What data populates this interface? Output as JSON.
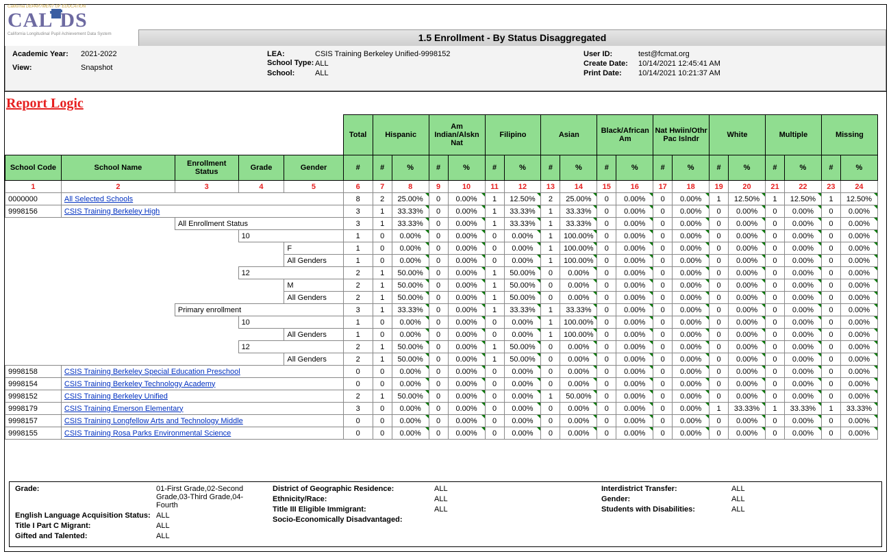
{
  "logo": {
    "top": "California DEPARTMENT OF EDUCATION",
    "main1": "CAL",
    "main2": "P",
    "main3": "DS",
    "sub": "California Longitudinal Pupil Achievement Data System"
  },
  "title": "1.5  Enrollment - By Status Disaggregated",
  "meta": {
    "ay_label": "Academic Year:",
    "ay": "2021-2022",
    "view_label": "View:",
    "view": "Snapshot",
    "lea_label": "LEA:",
    "lea": "CSIS Training Berkeley Unified-9998152",
    "st_label": "School Type:",
    "st": "ALL",
    "school_label": "School:",
    "school": "ALL",
    "uid_label": "User ID:",
    "uid": "test@fcmat.org",
    "cd_label": "Create Date:",
    "cd": "10/14/2021 12:45:41 AM",
    "pd_label": "Print Date:",
    "pd": "10/14/2021 10:21:37 AM"
  },
  "report_logic": "Report Logic",
  "groups": [
    "Total",
    "Hispanic",
    "Am Indian/Alskn Nat",
    "Filipino",
    "Asian",
    "Black/African Am",
    "Nat Hwiin/Othr Pac Islndr",
    "White",
    "Multiple",
    "Missing"
  ],
  "left_headers": [
    "School Code",
    "School Name",
    "Enrollment Status",
    "Grade",
    "Gender"
  ],
  "num_pct": {
    "num": "#",
    "pct": "%"
  },
  "red": [
    "1",
    "2",
    "3",
    "4",
    "5",
    "6",
    "7",
    "8",
    "9",
    "10",
    "11",
    "12",
    "13",
    "14",
    "15",
    "16",
    "17",
    "18",
    "19",
    "20",
    "21",
    "22",
    "23",
    "24"
  ],
  "rows": [
    {
      "c": "0000000",
      "n": "All Selected Schools",
      "d": [
        "8",
        "2",
        "25.00%",
        "0",
        "0.00%",
        "1",
        "12.50%",
        "2",
        "25.00%",
        "0",
        "0.00%",
        "0",
        "0.00%",
        "1",
        "12.50%",
        "1",
        "12.50%",
        "1",
        "12.50%"
      ]
    },
    {
      "c": "9998156",
      "n": "CSIS Training Berkeley High",
      "d": [
        "3",
        "1",
        "33.33%",
        "0",
        "0.00%",
        "1",
        "33.33%",
        "1",
        "33.33%",
        "0",
        "0.00%",
        "0",
        "0.00%",
        "0",
        "0.00%",
        "0",
        "0.00%",
        "0",
        "0.00%"
      ]
    },
    {
      "es": "All Enrollment Status",
      "d": [
        "3",
        "1",
        "33.33%",
        "0",
        "0.00%",
        "1",
        "33.33%",
        "1",
        "33.33%",
        "0",
        "0.00%",
        "0",
        "0.00%",
        "0",
        "0.00%",
        "0",
        "0.00%",
        "0",
        "0.00%"
      ]
    },
    {
      "gr": "10",
      "d": [
        "1",
        "0",
        "0.00%",
        "0",
        "0.00%",
        "0",
        "0.00%",
        "1",
        "100.00%",
        "0",
        "0.00%",
        "0",
        "0.00%",
        "0",
        "0.00%",
        "0",
        "0.00%",
        "0",
        "0.00%"
      ]
    },
    {
      "gn": "F",
      "d": [
        "1",
        "0",
        "0.00%",
        "0",
        "0.00%",
        "0",
        "0.00%",
        "1",
        "100.00%",
        "0",
        "0.00%",
        "0",
        "0.00%",
        "0",
        "0.00%",
        "0",
        "0.00%",
        "0",
        "0.00%"
      ]
    },
    {
      "gn": "All Genders",
      "d": [
        "1",
        "0",
        "0.00%",
        "0",
        "0.00%",
        "0",
        "0.00%",
        "1",
        "100.00%",
        "0",
        "0.00%",
        "0",
        "0.00%",
        "0",
        "0.00%",
        "0",
        "0.00%",
        "0",
        "0.00%"
      ]
    },
    {
      "gr": "12",
      "d": [
        "2",
        "1",
        "50.00%",
        "0",
        "0.00%",
        "1",
        "50.00%",
        "0",
        "0.00%",
        "0",
        "0.00%",
        "0",
        "0.00%",
        "0",
        "0.00%",
        "0",
        "0.00%",
        "0",
        "0.00%"
      ]
    },
    {
      "gn": "M",
      "d": [
        "2",
        "1",
        "50.00%",
        "0",
        "0.00%",
        "1",
        "50.00%",
        "0",
        "0.00%",
        "0",
        "0.00%",
        "0",
        "0.00%",
        "0",
        "0.00%",
        "0",
        "0.00%",
        "0",
        "0.00%"
      ]
    },
    {
      "gn": "All Genders",
      "d": [
        "2",
        "1",
        "50.00%",
        "0",
        "0.00%",
        "1",
        "50.00%",
        "0",
        "0.00%",
        "0",
        "0.00%",
        "0",
        "0.00%",
        "0",
        "0.00%",
        "0",
        "0.00%",
        "0",
        "0.00%"
      ]
    },
    {
      "es": "Primary enrollment",
      "d": [
        "3",
        "1",
        "33.33%",
        "0",
        "0.00%",
        "1",
        "33.33%",
        "1",
        "33.33%",
        "0",
        "0.00%",
        "0",
        "0.00%",
        "0",
        "0.00%",
        "0",
        "0.00%",
        "0",
        "0.00%"
      ]
    },
    {
      "gr": "10",
      "d": [
        "1",
        "0",
        "0.00%",
        "0",
        "0.00%",
        "0",
        "0.00%",
        "1",
        "100.00%",
        "0",
        "0.00%",
        "0",
        "0.00%",
        "0",
        "0.00%",
        "0",
        "0.00%",
        "0",
        "0.00%"
      ]
    },
    {
      "gn": "All Genders",
      "d": [
        "1",
        "0",
        "0.00%",
        "0",
        "0.00%",
        "0",
        "0.00%",
        "1",
        "100.00%",
        "0",
        "0.00%",
        "0",
        "0.00%",
        "0",
        "0.00%",
        "0",
        "0.00%",
        "0",
        "0.00%"
      ]
    },
    {
      "gr": "12",
      "d": [
        "2",
        "1",
        "50.00%",
        "0",
        "0.00%",
        "1",
        "50.00%",
        "0",
        "0.00%",
        "0",
        "0.00%",
        "0",
        "0.00%",
        "0",
        "0.00%",
        "0",
        "0.00%",
        "0",
        "0.00%"
      ]
    },
    {
      "gn": "All Genders",
      "d": [
        "2",
        "1",
        "50.00%",
        "0",
        "0.00%",
        "1",
        "50.00%",
        "0",
        "0.00%",
        "0",
        "0.00%",
        "0",
        "0.00%",
        "0",
        "0.00%",
        "0",
        "0.00%",
        "0",
        "0.00%"
      ]
    },
    {
      "c": "9998158",
      "n": "CSIS Training Berkeley Special Education Preschool",
      "d": [
        "0",
        "0",
        "0.00%",
        "0",
        "0.00%",
        "0",
        "0.00%",
        "0",
        "0.00%",
        "0",
        "0.00%",
        "0",
        "0.00%",
        "0",
        "0.00%",
        "0",
        "0.00%",
        "0",
        "0.00%"
      ]
    },
    {
      "c": "9998154",
      "n": "CSIS Training Berkeley Technology Academy",
      "d": [
        "0",
        "0",
        "0.00%",
        "0",
        "0.00%",
        "0",
        "0.00%",
        "0",
        "0.00%",
        "0",
        "0.00%",
        "0",
        "0.00%",
        "0",
        "0.00%",
        "0",
        "0.00%",
        "0",
        "0.00%"
      ]
    },
    {
      "c": "9998152",
      "n": "CSIS Training Berkeley Unified",
      "d": [
        "2",
        "1",
        "50.00%",
        "0",
        "0.00%",
        "0",
        "0.00%",
        "1",
        "50.00%",
        "0",
        "0.00%",
        "0",
        "0.00%",
        "0",
        "0.00%",
        "0",
        "0.00%",
        "0",
        "0.00%"
      ]
    },
    {
      "c": "9998179",
      "n": "CSIS Training Emerson Elementary",
      "d": [
        "3",
        "0",
        "0.00%",
        "0",
        "0.00%",
        "0",
        "0.00%",
        "0",
        "0.00%",
        "0",
        "0.00%",
        "0",
        "0.00%",
        "1",
        "33.33%",
        "1",
        "33.33%",
        "1",
        "33.33%"
      ]
    },
    {
      "c": "9998157",
      "n": "CSIS Training Longfellow Arts and Technology Middle",
      "d": [
        "0",
        "0",
        "0.00%",
        "0",
        "0.00%",
        "0",
        "0.00%",
        "0",
        "0.00%",
        "0",
        "0.00%",
        "0",
        "0.00%",
        "0",
        "0.00%",
        "0",
        "0.00%",
        "0",
        "0.00%"
      ]
    },
    {
      "c": "9998155",
      "n": "CSIS Training Rosa Parks Environmental Science",
      "d": [
        "0",
        "0",
        "0.00%",
        "0",
        "0.00%",
        "0",
        "0.00%",
        "0",
        "0.00%",
        "0",
        "0.00%",
        "0",
        "0.00%",
        "0",
        "0.00%",
        "0",
        "0.00%",
        "0",
        "0.00%"
      ]
    }
  ],
  "filters": {
    "c1": [
      {
        "l": "Grade:",
        "v": "01-First Grade,02-Second Grade,03-Third Grade,04-Fourth",
        "wrap": true
      },
      {
        "l": "English Language Acquisition Status:",
        "v": "ALL"
      },
      {
        "l": "Title I Part C Migrant:",
        "v": "ALL"
      },
      {
        "l": "Gifted and Talented:",
        "v": "ALL"
      }
    ],
    "c2": [
      {
        "l": "District of Geographic Residence:",
        "v": "ALL"
      },
      {
        "l": "Ethnicity/Race:",
        "v": "ALL"
      },
      {
        "l": "Title III Eligible Immigrant:",
        "v": "ALL"
      },
      {
        "l": "Socio-Economically Disadvantaged:",
        "v": ""
      }
    ],
    "c3": [
      {
        "l": "Interdistrict Transfer:",
        "v": "ALL"
      },
      {
        "l": "Gender:",
        "v": "ALL"
      },
      {
        "l": "Students with Disabilities:",
        "v": "ALL"
      }
    ]
  },
  "colwidths": {
    "code": 76,
    "name": 154,
    "es": 86,
    "grade": 62,
    "gender": 80,
    "total": 40,
    "n": 26,
    "p": 50
  }
}
